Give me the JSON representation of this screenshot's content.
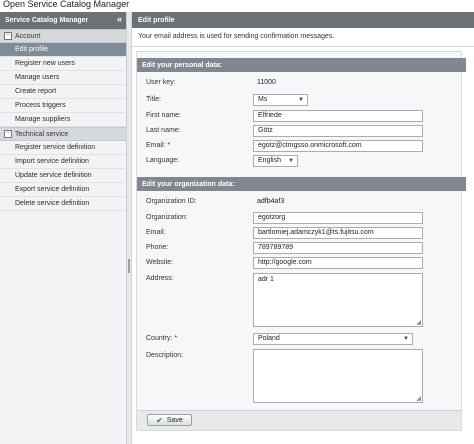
{
  "app": {
    "title": "Open Service Catalog Manager"
  },
  "sidebar": {
    "header": "Service Catalog Manager",
    "collapse_label": "«",
    "sections": [
      {
        "label": "Account",
        "toggle": "−",
        "items": [
          "Edit profile",
          "Register new users",
          "Manage users",
          "Create report",
          "Process triggers",
          "Manage suppliers"
        ]
      },
      {
        "label": "Technical service",
        "toggle": "−",
        "items": [
          "Register service definition",
          "Import service definition",
          "Update service definition",
          "Export service definition",
          "Delete service definition"
        ]
      }
    ],
    "active_item": "Edit profile"
  },
  "main": {
    "title": "Edit profile",
    "info": "Your email address is used for sending confirmation messages."
  },
  "personal": {
    "heading": "Edit your personal data:",
    "user_key_label": "User key:",
    "user_key": "11000",
    "title_label": "Title:",
    "title_value": "Ms",
    "first_name_label": "First name:",
    "first_name": "Elfriede",
    "last_name_label": "Last name:",
    "last_name": "Götz",
    "email_label": "Email:",
    "email": "egotz@ctmgsso.onmicrosoft.com",
    "language_label": "Language:",
    "language": "English"
  },
  "organization": {
    "heading": "Edit your organization data:",
    "org_id_label": "Organization ID:",
    "org_id": "adfb4af3",
    "org_label": "Organization:",
    "org": "egotzorg",
    "email_label": "Email:",
    "email": "bartlomiej.adamczyk1@ts.fujitsu.com",
    "phone_label": "Phone:",
    "phone": "789789789",
    "website_label": "Website:",
    "website": "http://google.com",
    "address_label": "Address:",
    "address": "adr 1",
    "country_label": "Country:",
    "country": "Poland",
    "description_label": "Description:",
    "description": ""
  },
  "footer": {
    "save_label": "Save"
  },
  "colors": {
    "header": "#6c7176",
    "active_nav": "#7f8b96",
    "required": "#cc0000"
  }
}
